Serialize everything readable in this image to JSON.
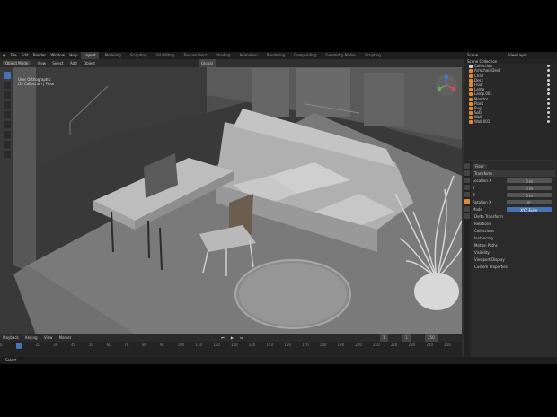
{
  "app": {
    "menus": [
      "File",
      "Edit",
      "Render",
      "Window",
      "Help"
    ],
    "tabs": [
      "Layout",
      "Modeling",
      "Sculpting",
      "UV Editing",
      "Texture Paint",
      "Shading",
      "Animation",
      "Rendering",
      "Compositing",
      "Geometry Nodes",
      "Scripting"
    ],
    "active_tab": "Layout",
    "scene_label": "Scene",
    "view_layer_label": "ViewLayer"
  },
  "viewport": {
    "mode": "Object Mode",
    "header_items": [
      "View",
      "Select",
      "Add",
      "Object"
    ],
    "orientation": "Global",
    "overlay_lines": [
      "User Orthographic",
      "(1) Collection | Floor"
    ],
    "accent_color": "#e08a35"
  },
  "outliner": {
    "title": "Scene Collection",
    "rows": [
      "Collection",
      "Armchair Desk",
      "Chair",
      "Desk",
      "Floor",
      "Lamp",
      "Lamp.001",
      "Monitor",
      "Plant",
      "Rug",
      "Sofa",
      "Wall",
      "Wall.001"
    ]
  },
  "properties": {
    "object_name": "Floor",
    "sections": [
      "Transform",
      "Delta Transform",
      "Relations",
      "Collections",
      "Instancing",
      "Motion Paths",
      "Visibility",
      "Viewport Display",
      "Custom Properties"
    ],
    "fields": [
      {
        "label": "Location X",
        "value": "0 m"
      },
      {
        "label": "Y",
        "value": "0 m"
      },
      {
        "label": "Z",
        "value": "0 m"
      },
      {
        "label": "Rotation X",
        "value": "0°"
      },
      {
        "label": "Mode",
        "value": "XYZ Euler"
      }
    ]
  },
  "timeline": {
    "header": [
      "Playback",
      "Keying",
      "View",
      "Marker"
    ],
    "frames": [
      "0",
      "10",
      "20",
      "30",
      "40",
      "50",
      "60",
      "70",
      "80",
      "90",
      "100",
      "110",
      "120",
      "130",
      "140",
      "150",
      "160",
      "170",
      "180",
      "190",
      "200",
      "210",
      "220",
      "230",
      "240",
      "250"
    ],
    "current_frame": "1",
    "start": "1",
    "end": "250"
  },
  "status": "Select"
}
